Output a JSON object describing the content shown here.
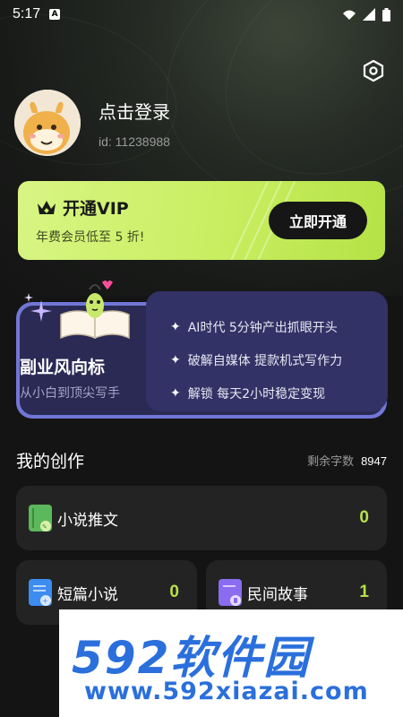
{
  "status_bar": {
    "time": "5:17",
    "notif_letter": "A"
  },
  "profile": {
    "login_text": "点击登录",
    "user_id": "id: 11238988"
  },
  "vip": {
    "title": "开通VIP",
    "subtitle": "年费会员低至 5 折!",
    "button": "立即开通",
    "accent": "#c9ee61"
  },
  "banner": {
    "title": "副业风向标",
    "subtitle": "从小白到顶尖写手",
    "features": [
      "AI时代 5分钟产出抓眼开头",
      "破解自媒体 提款机式写作力",
      "解锁 每天2小时稳定变现"
    ]
  },
  "creation": {
    "title": "我的创作",
    "remaining_label": "剩余字数",
    "remaining_count": "8947",
    "items": [
      {
        "label": "小说推文",
        "count": "0",
        "icon": "green-book-icon"
      },
      {
        "label": "短篇小说",
        "count": "0",
        "icon": "blue-doc-icon"
      },
      {
        "label": "民间故事",
        "count": "1",
        "icon": "purple-doc-icon"
      }
    ]
  },
  "watermark": {
    "logo": "592软件园",
    "url": "www.592xiazai.com"
  }
}
